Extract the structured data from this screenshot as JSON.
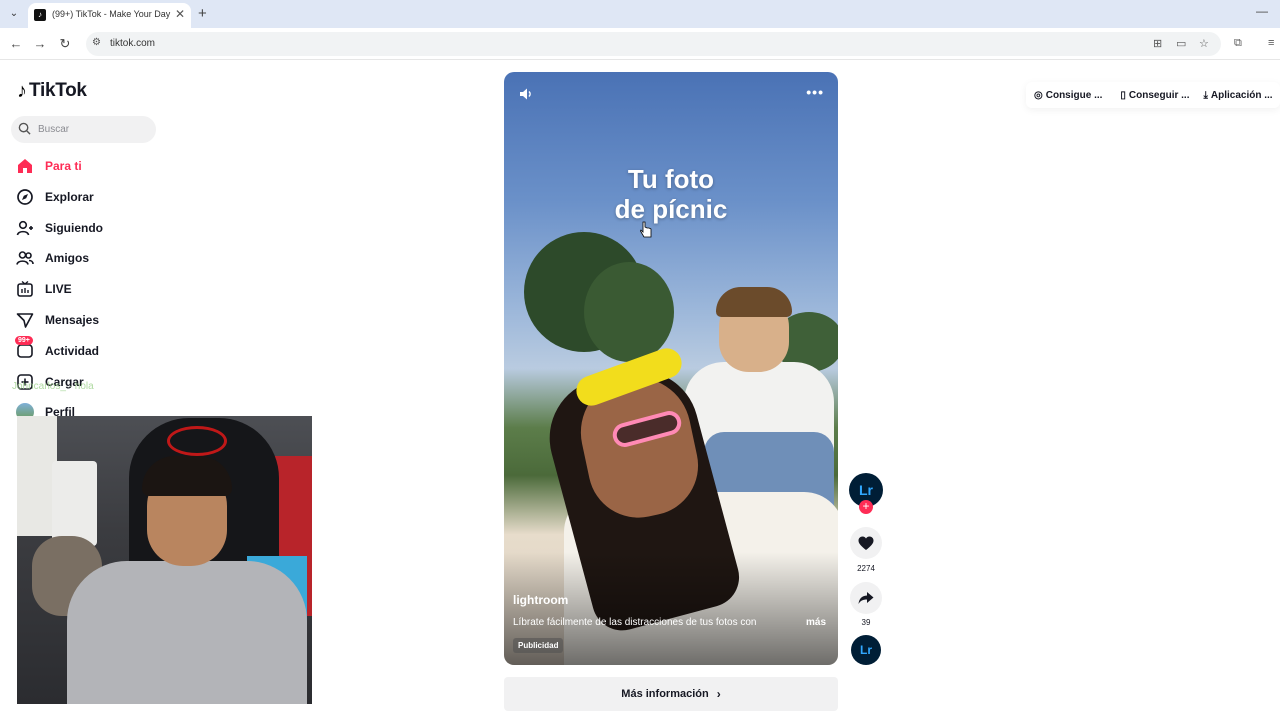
{
  "browser": {
    "tab_title": "(99+) TikTok - Make Your Day",
    "url": "tiktok.com"
  },
  "sidebar": {
    "logo": "TikTok",
    "search_placeholder": "Buscar",
    "items": [
      {
        "label": "Para ti",
        "icon": "home-icon",
        "active": true
      },
      {
        "label": "Explorar",
        "icon": "compass-icon"
      },
      {
        "label": "Siguiendo",
        "icon": "following-icon"
      },
      {
        "label": "Amigos",
        "icon": "friends-icon"
      },
      {
        "label": "LIVE",
        "icon": "live-icon"
      },
      {
        "label": "Mensajes",
        "icon": "messages-icon"
      },
      {
        "label": "Actividad",
        "icon": "activity-icon",
        "badge": "99+"
      },
      {
        "label": "Cargar",
        "icon": "upload-icon"
      },
      {
        "label": "Perfil",
        "icon": "profile-avatar"
      }
    ],
    "overlay_text": "Johncarlos_ · hola"
  },
  "video": {
    "caption": [
      "Tu foto",
      "de pícnic"
    ],
    "author": "lightroom",
    "description": "Líbrate fácilmente de las distracciones de tus fotos con",
    "more": "más",
    "ad_label": "Publicidad"
  },
  "more_info": "Más información",
  "actions": {
    "avatar_text": "Lr",
    "likes": "2274",
    "shares": "39",
    "disc_text": "Lr"
  },
  "top_links": [
    {
      "label": "Consigue ...",
      "icon": "coin-icon"
    },
    {
      "label": "Conseguir ...",
      "icon": "phone-icon"
    },
    {
      "label": "Aplicación ...",
      "icon": "download-icon"
    }
  ],
  "colors": {
    "accent": "#fe2c55",
    "text": "#161823"
  }
}
